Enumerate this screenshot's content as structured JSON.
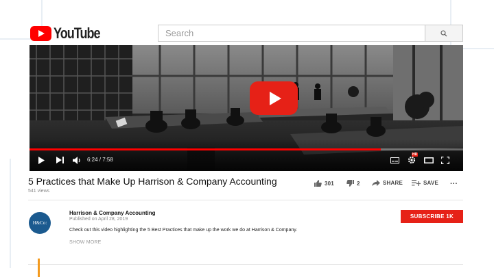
{
  "header": {
    "logo_text": "YouTube",
    "search_placeholder": "Search"
  },
  "player": {
    "time_display": "6:24 / 7:58",
    "progress_fraction": 0.81,
    "hd_badge": "HD"
  },
  "video": {
    "title": "5 Practices that Make Up Harrison & Company Accounting",
    "views": "541 views",
    "likes": "301",
    "dislikes": "2",
    "share_label": "SHARE",
    "save_label": "SAVE",
    "more_label": "···"
  },
  "channel": {
    "avatar_text": "H&Co:",
    "name": "Harrison & Company Accounting",
    "published": "Published on April 28, 2019",
    "description": "Check out this video highlighting the 5 Best Practices that make up the work we do at Harrison & Company.",
    "show_more": "SHOW MORE",
    "subscribe_label": "SUBSCRIBE 1K"
  },
  "colors": {
    "brand_red": "#e62117",
    "accent_orange": "#f39a1e"
  },
  "icons": [
    "search-icon",
    "play-icon",
    "next-icon",
    "volume-icon",
    "subtitles-icon",
    "settings-icon",
    "theater-icon",
    "fullscreen-icon",
    "thumbs-up-icon",
    "thumbs-down-icon",
    "share-icon",
    "save-icon",
    "more-icon"
  ]
}
